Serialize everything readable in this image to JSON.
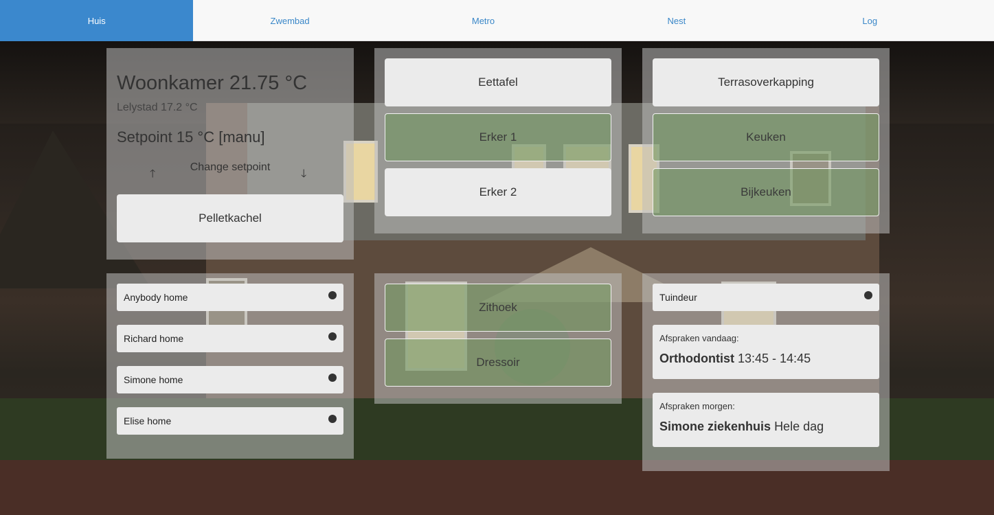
{
  "nav": {
    "tabs": [
      {
        "label": "Huis",
        "active": true
      },
      {
        "label": "Zwembad",
        "active": false
      },
      {
        "label": "Metro",
        "active": false
      },
      {
        "label": "Nest",
        "active": false
      },
      {
        "label": "Log",
        "active": false
      }
    ]
  },
  "thermostat": {
    "title": "Woonkamer 21.75 °C",
    "outside": "Lelystad 17.2 °C",
    "setpoint": "Setpoint 15 °C [manu]",
    "up_icon": "arrow-up-icon",
    "up_glyph": "🡑",
    "change_label": "Change setpoint",
    "down_icon": "arrow-down-icon",
    "down_glyph": "🡓",
    "pellet_button": "Pelletkachel"
  },
  "lights_center": {
    "eettafel": "Eettafel",
    "erker1": "Erker 1",
    "erker2": "Erker 2"
  },
  "lights_right": {
    "terras": "Terrasoverkapping",
    "keuken": "Keuken",
    "bijkeuken": "Bijkeuken"
  },
  "presence": [
    {
      "label": "Anybody home"
    },
    {
      "label": "Richard home"
    },
    {
      "label": "Simone home"
    },
    {
      "label": "Elise home"
    }
  ],
  "lights_lower": {
    "zithoek": "Zithoek",
    "dressoir": "Dressoir"
  },
  "door": {
    "label": "Tuindeur"
  },
  "agenda": {
    "today_label": "Afspraken vandaag:",
    "today_title": "Orthodontist",
    "today_time": "13:45 - 14:45",
    "tomorrow_label": "Afspraken morgen:",
    "tomorrow_title": "Simone ziekenhuis",
    "tomorrow_time": "Hele dag"
  },
  "colors": {
    "nav_active": "#3b88cd",
    "nav_text": "#3a87c8",
    "switch_on": "#6e965a",
    "switch_off": "#ebebeb"
  }
}
